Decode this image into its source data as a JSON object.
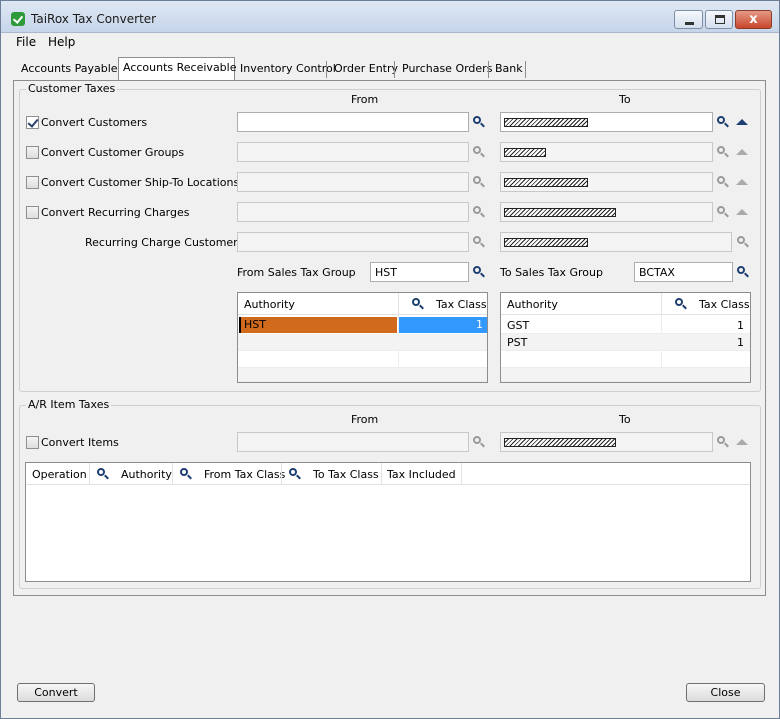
{
  "window": {
    "title": "TaiRox Tax Converter",
    "close_glyph": "x"
  },
  "menu": {
    "items": [
      "File",
      "Help"
    ]
  },
  "tabs": [
    {
      "label": "Accounts Payable"
    },
    {
      "label": "Accounts Receivable",
      "selected": true
    },
    {
      "label": "Inventory Control"
    },
    {
      "label": "Order Entry"
    },
    {
      "label": "Purchase Orders"
    },
    {
      "label": "Bank"
    }
  ],
  "customer_taxes": {
    "title": "Customer Taxes",
    "from_header": "From",
    "to_header": "To",
    "rows": [
      {
        "label": "Convert Customers",
        "checked": true
      },
      {
        "label": "Convert Customer Groups",
        "checked": false
      },
      {
        "label": "Convert Customer Ship-To Locations",
        "checked": false
      },
      {
        "label": "Convert Recurring Charges",
        "checked": false
      },
      {
        "label": "Recurring Charge Customer"
      }
    ],
    "from_sales_tax_group": {
      "label": "From Sales Tax Group",
      "value": "HST"
    },
    "to_sales_tax_group": {
      "label": "To Sales Tax Group",
      "value": "BCTAX"
    },
    "from_grid": {
      "headers": [
        "Authority",
        "Tax Class"
      ],
      "rows": [
        {
          "authority": "HST",
          "tax_class": "1"
        }
      ]
    },
    "to_grid": {
      "headers": [
        "Authority",
        "Tax Class"
      ],
      "rows": [
        {
          "authority": "GST",
          "tax_class": "1"
        },
        {
          "authority": "PST",
          "tax_class": "1"
        }
      ]
    }
  },
  "item_taxes": {
    "title": "A/R Item Taxes",
    "from_header": "From",
    "to_header": "To",
    "convert_items": {
      "label": "Convert Items",
      "checked": false
    },
    "grid_headers": [
      "Operation",
      "Authority",
      "From Tax Class",
      "To Tax Class",
      "Tax Included"
    ]
  },
  "buttons": {
    "convert": "Convert",
    "close": "Close"
  },
  "colors": {
    "selected_row": "#d16a1c",
    "selected_cell": "#3399ff"
  }
}
